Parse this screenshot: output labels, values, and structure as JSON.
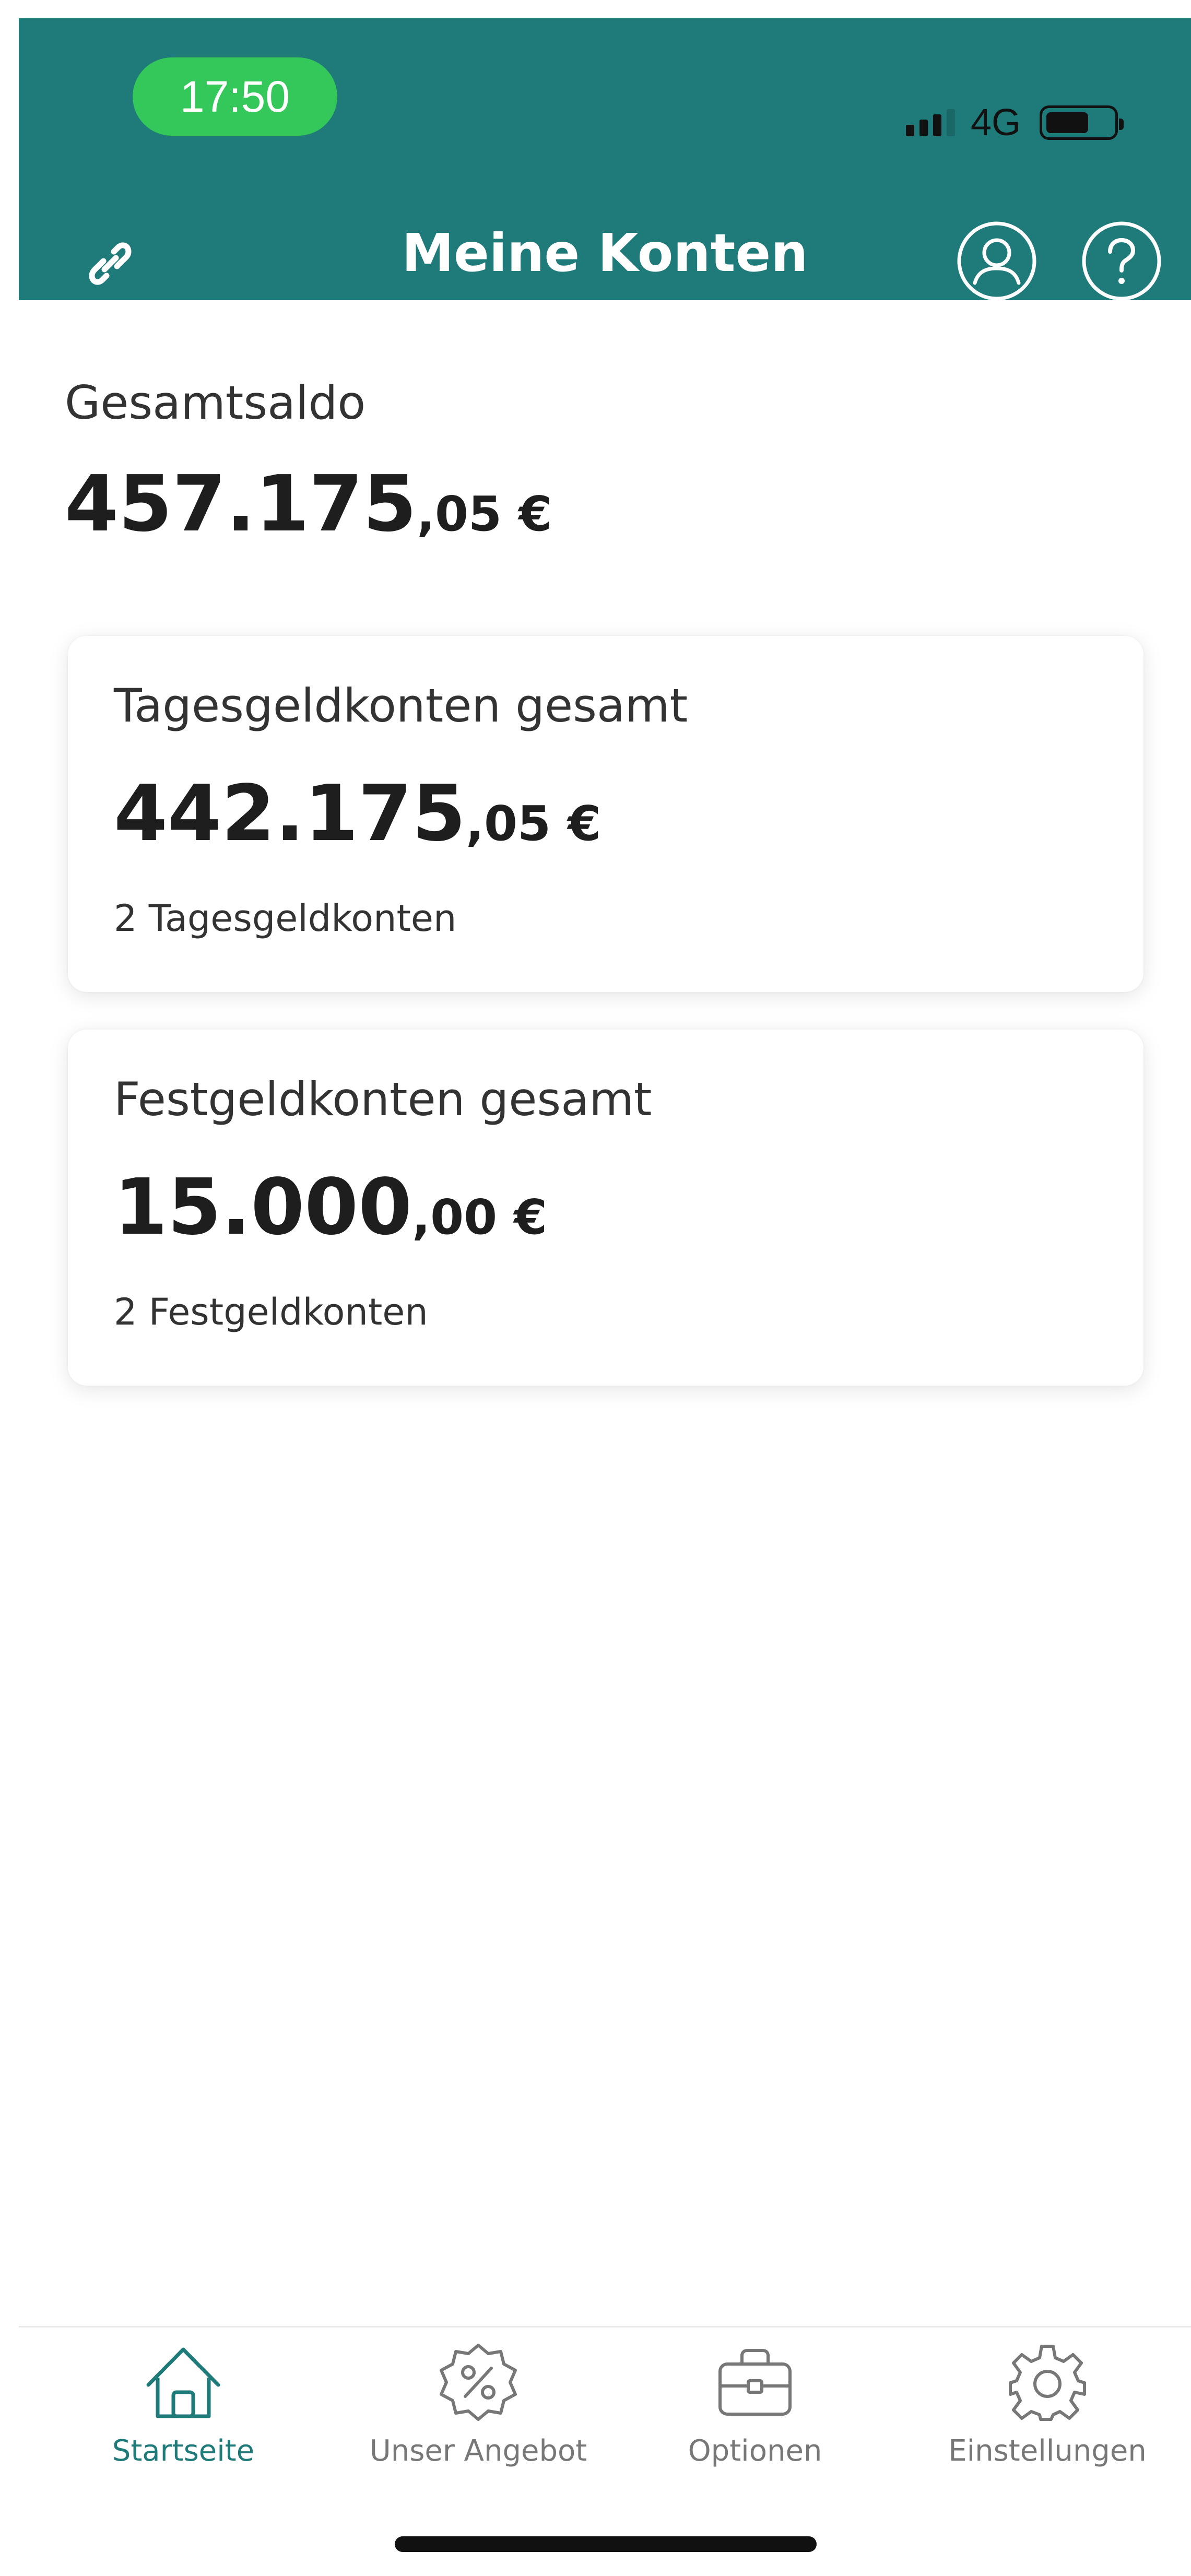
{
  "status_bar": {
    "time": "17:50",
    "network": "4G",
    "battery_level_percent": 70
  },
  "header": {
    "title": "Meine Konten",
    "left_icon": "link-icon",
    "profile_icon": "user-icon",
    "help_icon": "question-icon"
  },
  "summary": {
    "label": "Gesamtsaldo",
    "amount_main": "457.175",
    "amount_cents": ",05 €"
  },
  "cards": [
    {
      "title": "Tagesgeldkonten gesamt",
      "amount_main": "442.175",
      "amount_cents": ",05 €",
      "subtitle": "2 Tagesgeldkonten"
    },
    {
      "title": "Festgeldkonten gesamt",
      "amount_main": "15.000",
      "amount_cents": ",00 €",
      "subtitle": "2 Festgeldkonten"
    }
  ],
  "bottom_nav": [
    {
      "label": "Startseite",
      "icon": "home-icon",
      "active": true
    },
    {
      "label": "Unser Angebot",
      "icon": "percent-badge-icon",
      "active": false
    },
    {
      "label": "Optionen",
      "icon": "briefcase-icon",
      "active": false
    },
    {
      "label": "Einstellungen",
      "icon": "gear-icon",
      "active": false
    }
  ],
  "colors": {
    "brand": "#1f7a7a",
    "status_pill": "#34c759",
    "text_dark": "#1e1e1e",
    "nav_inactive": "#777777"
  }
}
